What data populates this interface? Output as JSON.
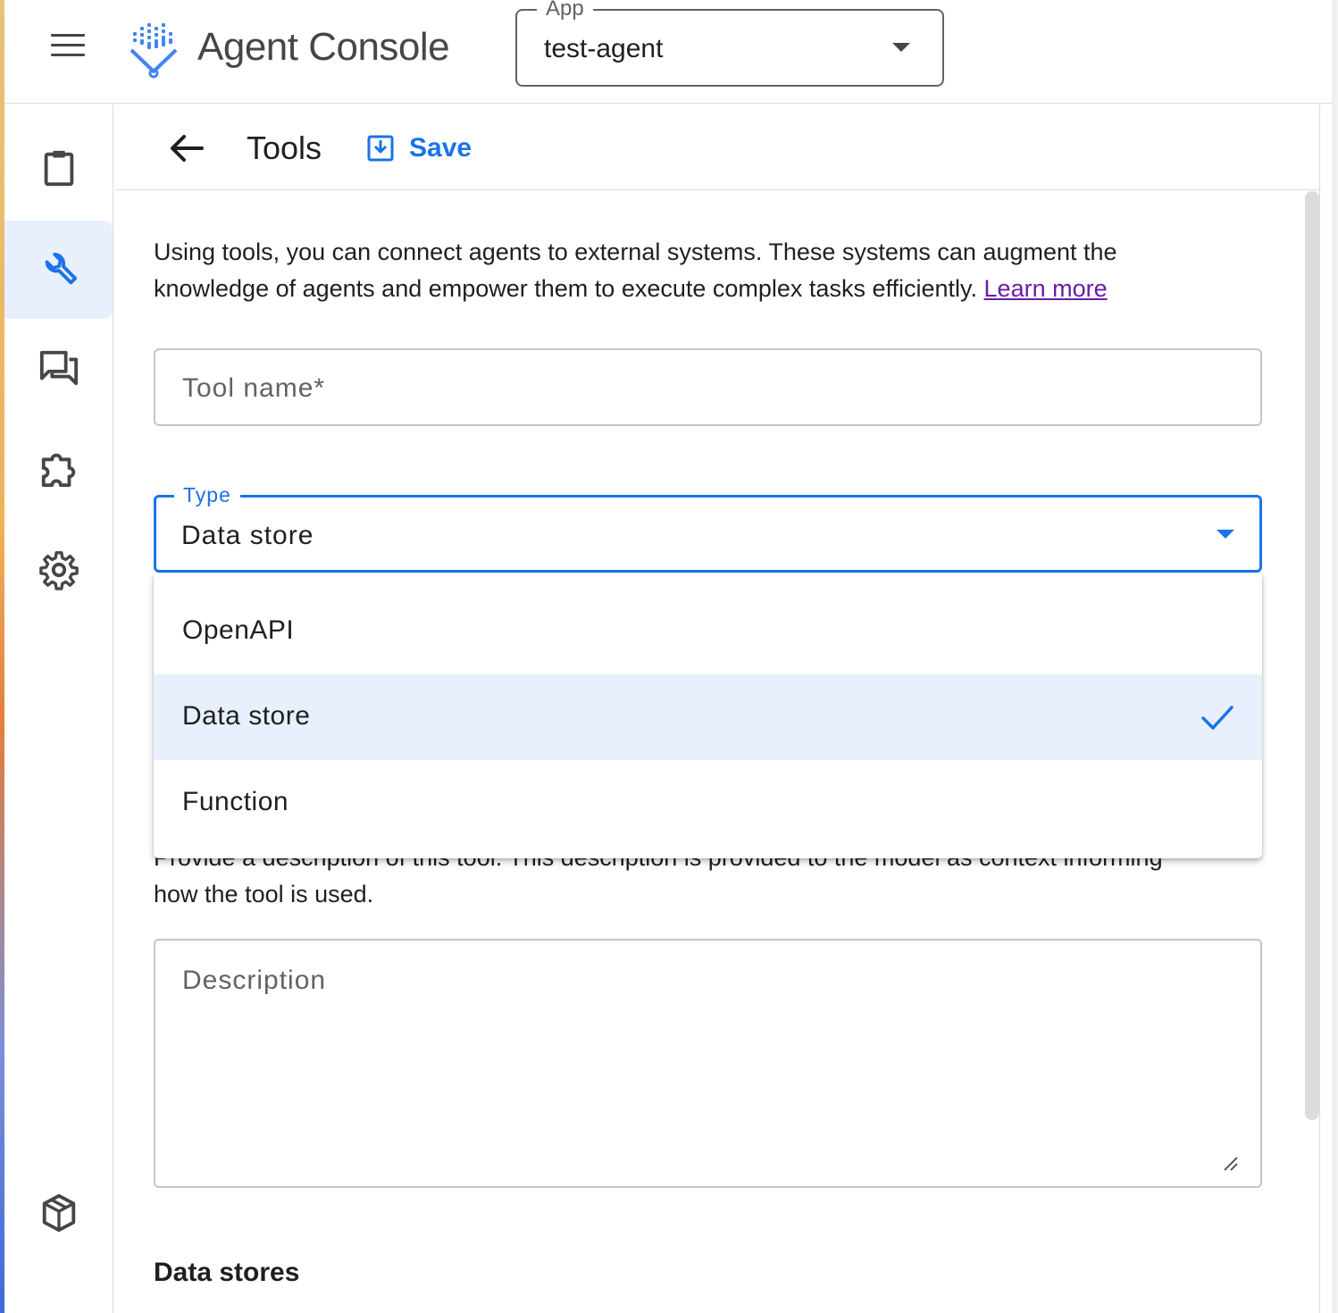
{
  "app": {
    "name": "Agent Console",
    "selector_label": "App",
    "selector_value": "test-agent"
  },
  "nav": {
    "items": [
      {
        "icon": "clipboard-icon",
        "active": false
      },
      {
        "icon": "wrench-icon",
        "active": true
      },
      {
        "icon": "chat-icon",
        "active": false
      },
      {
        "icon": "puzzle-icon",
        "active": false
      },
      {
        "icon": "gear-icon",
        "active": false
      },
      {
        "icon": "cube-icon",
        "active": false
      }
    ]
  },
  "header": {
    "title": "Tools",
    "save_label": "Save"
  },
  "intro": {
    "text": "Using tools, you can connect agents to external systems. These systems can augment the knowledge of agents and empower them to execute complex tasks efficiently.",
    "link": "Learn more"
  },
  "form": {
    "tool_name_placeholder": "Tool name*",
    "type_label": "Type",
    "type_value": "Data store",
    "type_options": [
      {
        "label": "OpenAPI",
        "selected": false
      },
      {
        "label": "Data store",
        "selected": true
      },
      {
        "label": "Function",
        "selected": false
      }
    ],
    "description_help_partial": "Provide a description of this tool. This description is provided to the model as context informing",
    "description_help_visible": "how the tool is used.",
    "description_placeholder": "Description",
    "data_stores_heading": "Data stores"
  },
  "colors": {
    "accent": "#1a73e8",
    "selected_bg": "#e8f0fe",
    "link_visited": "#681da8",
    "text": "#1f1f1f",
    "border": "#c4c7c5"
  }
}
